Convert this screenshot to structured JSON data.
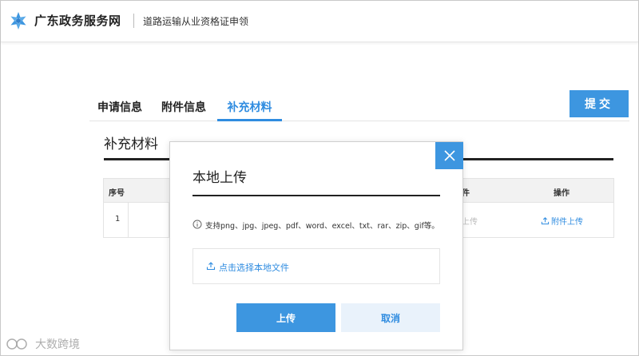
{
  "header": {
    "site_name": "广东政务服务网",
    "sub_title": "道路运输从业资格证申领"
  },
  "tabs": [
    {
      "label": "申请信息",
      "active": false
    },
    {
      "label": "附件信息",
      "active": false
    },
    {
      "label": "补充材料",
      "active": true
    }
  ],
  "toolbar": {
    "submit_label": "提交"
  },
  "section": {
    "title": "补充材料"
  },
  "table": {
    "headers": {
      "no": "序号",
      "file_visible": "件",
      "operation": "操作"
    },
    "rows": [
      {
        "no": "1",
        "upload_partial": "上传",
        "action": "附件上传"
      }
    ]
  },
  "modal": {
    "title": "本地上传",
    "hint": "支持png、jpg、jpeg、pdf、word、excel、txt、rar、zip、gif等。",
    "file_picker_label": "点击选择本地文件",
    "upload_label": "上传",
    "cancel_label": "取消"
  },
  "watermark": {
    "text": "大数跨境"
  },
  "colors": {
    "accent": "#3d96e0",
    "link": "#2f8ce0",
    "cancel_bg": "#e9f2fb"
  }
}
